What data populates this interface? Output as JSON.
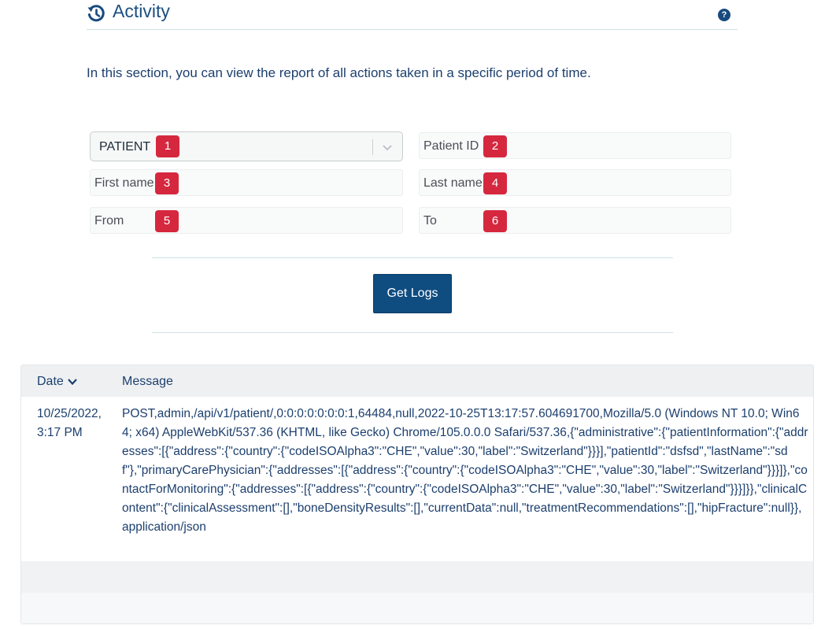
{
  "header": {
    "title": "Activity",
    "help_label": "?"
  },
  "intro": "In this section, you can view the report of all actions taken in a specific period of time.",
  "form": {
    "entity_select": {
      "value": "PATIENT",
      "badge": "1"
    },
    "patient_id": {
      "label": "Patient ID",
      "badge": "2"
    },
    "first_name": {
      "label": "First name",
      "badge": "3"
    },
    "last_name": {
      "label": "Last name",
      "badge": "4"
    },
    "from": {
      "label": "From",
      "badge": "5"
    },
    "to": {
      "label": "To",
      "badge": "6"
    },
    "submit_label": "Get Logs"
  },
  "table": {
    "columns": {
      "date": "Date",
      "message": "Message"
    },
    "rows": [
      {
        "date": "10/25/2022, 3:17 PM",
        "message": "POST,admin,/api/v1/patient/,0:0:0:0:0:0:0:1,64484,null,2022-10-25T13:17:57.604691700,Mozilla/5.0 (Windows NT 10.0; Win64; x64) AppleWebKit/537.36 (KHTML, like Gecko) Chrome/105.0.0.0 Safari/537.36,{\"administrative\":{\"patientInformation\":{\"addresses\":[{\"address\":{\"country\":{\"codeISOAlpha3\":\"CHE\",\"value\":30,\"label\":\"Switzerland\"}}}],\"patientId\":\"dsfsd\",\"lastName\":\"sdf\"},\"primaryCarePhysician\":{\"addresses\":[{\"address\":{\"country\":{\"codeISOAlpha3\":\"CHE\",\"value\":30,\"label\":\"Switzerland\"}}}]},\"contactForMonitoring\":{\"addresses\":[{\"address\":{\"country\":{\"codeISOAlpha3\":\"CHE\",\"value\":30,\"label\":\"Switzerland\"}}}]}},\"clinicalContent\":{\"clinicalAssessment\":[],\"boneDensityResults\":[],\"currentData\":null,\"treatmentRecommendations\":[],\"hipFracture\":null}},application/json"
      }
    ]
  },
  "colors": {
    "primary": "#0f4c80",
    "badge": "#d5283f",
    "text": "#1c3f6e",
    "divider": "#cfe1e6"
  },
  "icons": {
    "header": "history-icon",
    "help": "help-icon",
    "select": "chevron-down-icon",
    "sort": "sort-down-icon"
  }
}
